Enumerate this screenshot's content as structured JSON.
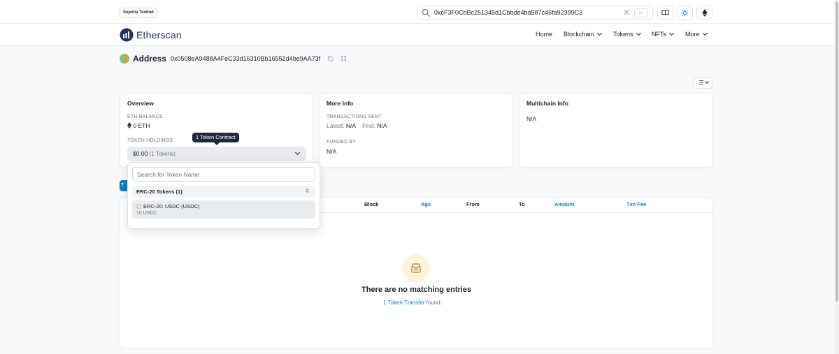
{
  "topbar": {
    "network_badge": "Sepolia Testnet",
    "search_value": "0xcF3F0CbBc251345d1Cbbde4ba587c46fa92399C3",
    "enter_symbol": "↵"
  },
  "navbar": {
    "logo_text": "Etherscan",
    "items": [
      {
        "label": "Home"
      },
      {
        "label": "Blockchain"
      },
      {
        "label": "Tokens"
      },
      {
        "label": "NFTs"
      },
      {
        "label": "More"
      }
    ]
  },
  "address": {
    "label": "Address",
    "hash": "0x0508eA9488A4FeC33d16310Bb16552d4be9AA73f"
  },
  "overview": {
    "title": "Overview",
    "eth_balance_label": "ETH BALANCE",
    "eth_balance_value": "0 ETH",
    "token_holdings_label": "TOKEN HOLDINGS",
    "token_holdings_value": "$0.00",
    "token_holdings_count": "(1 Tokens)",
    "tooltip": "1 Token Contract"
  },
  "more_info": {
    "title": "More Info",
    "tx_sent_label": "TRANSACTIONS SENT",
    "latest_label": "Latest:",
    "latest_value": "N/A",
    "first_label": "First:",
    "first_value": "N/A",
    "funded_by_label": "FUNDED BY",
    "funded_by_value": "N/A"
  },
  "multichain": {
    "title": "Multichain Info",
    "value": "N/A"
  },
  "dropdown": {
    "search_placeholder": "Search for Token Name",
    "group_label": "ERC-20 Tokens (1)",
    "items": [
      {
        "name": "ERC-20: USDC (USDC)",
        "amount": "10 USDC"
      }
    ]
  },
  "tab_fragment": "T",
  "table": {
    "columns": [
      "Block",
      "Age",
      "From",
      "To",
      "Amount",
      "Txn Fee"
    ]
  },
  "empty_state": {
    "title": "There are no matching entries",
    "link_text": "1 Token Transfer",
    "suffix": " found."
  },
  "colors": {
    "link": "#0784c3",
    "brand_navy": "#21325b",
    "tooltip_bg": "#1e2a3b"
  }
}
